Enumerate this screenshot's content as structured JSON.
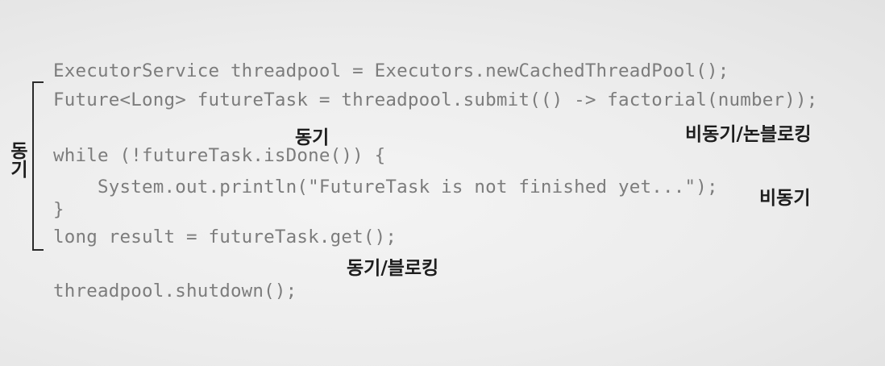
{
  "code": {
    "line1": "ExecutorService threadpool = Executors.newCachedThreadPool();",
    "line2": "Future<Long> futureTask = threadpool.submit(() -> factorial(number));",
    "line3": "while (!futureTask.isDone()) {",
    "line4": "    System.out.println(\"FutureTask is not finished yet...\");",
    "line5": "}",
    "line6": "long result = futureTask.get();",
    "line7": "threadpool.shutdown();"
  },
  "annotations": {
    "sync_top": "동기",
    "async_nonblocking": "비동기/논블로킹",
    "async_println": "비동기",
    "sync_blocking": "동기/블로킹",
    "bracket_label": "동기"
  }
}
